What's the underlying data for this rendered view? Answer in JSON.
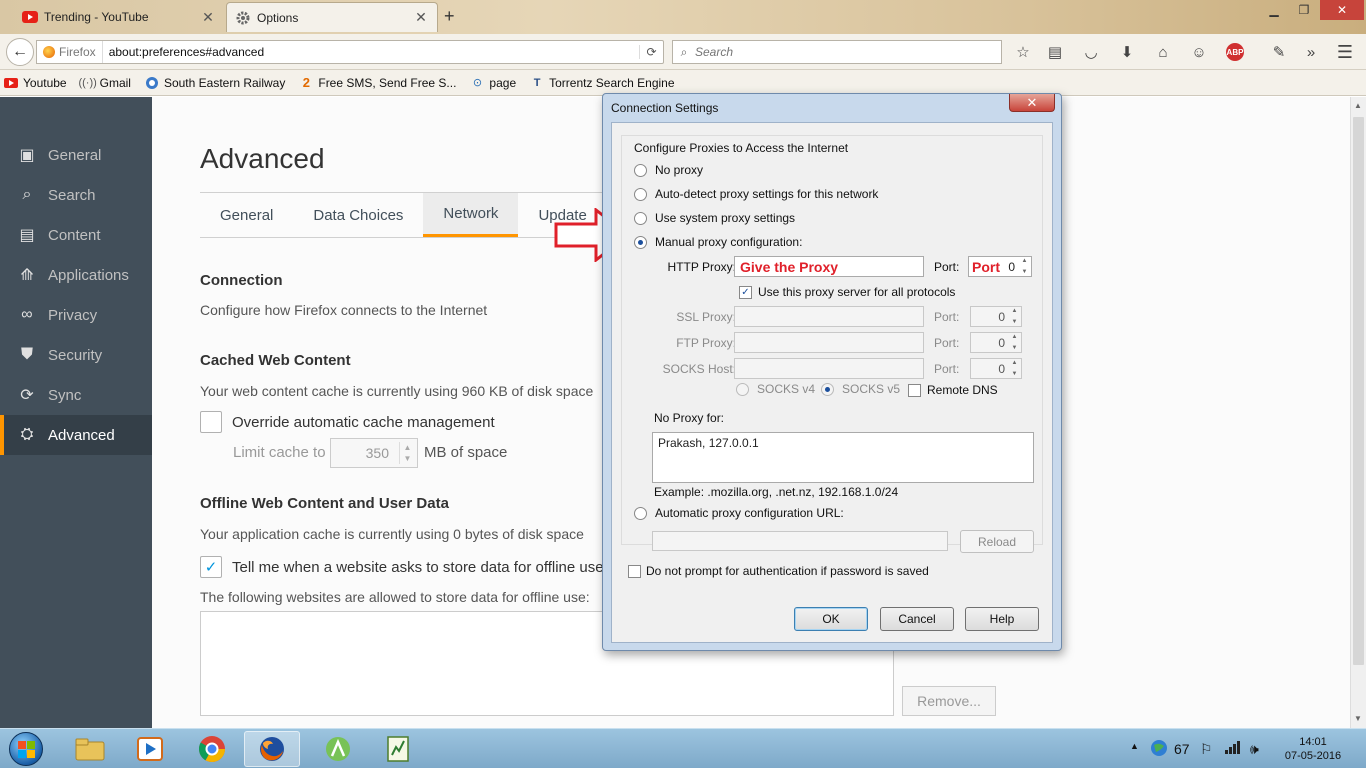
{
  "tabs": [
    {
      "title": "Trending - YouTube",
      "active": false
    },
    {
      "title": "Options",
      "active": true
    }
  ],
  "navbar": {
    "identity_label": "Firefox",
    "url": "about:preferences#advanced",
    "search_placeholder": "Search"
  },
  "bookmarks": [
    {
      "label": "Youtube"
    },
    {
      "label": "Gmail"
    },
    {
      "label": "South Eastern Railway"
    },
    {
      "label": "Free SMS, Send Free S..."
    },
    {
      "label": "page"
    },
    {
      "label": "Torrentz Search Engine"
    }
  ],
  "sidebar": {
    "items": [
      {
        "label": "General",
        "icon": "general-icon"
      },
      {
        "label": "Search",
        "icon": "search-icon"
      },
      {
        "label": "Content",
        "icon": "content-icon"
      },
      {
        "label": "Applications",
        "icon": "applications-icon"
      },
      {
        "label": "Privacy",
        "icon": "privacy-mask-icon"
      },
      {
        "label": "Security",
        "icon": "security-icon"
      },
      {
        "label": "Sync",
        "icon": "sync-icon"
      },
      {
        "label": "Advanced",
        "icon": "advanced-icon",
        "selected": true
      }
    ]
  },
  "main": {
    "title": "Advanced",
    "subtabs": [
      "General",
      "Data Choices",
      "Network",
      "Update"
    ],
    "active_subtab": "Network",
    "connection": {
      "heading": "Connection",
      "description": "Configure how Firefox connects to the Internet"
    },
    "cache": {
      "heading": "Cached Web Content",
      "description": "Your web content cache is currently using 960 KB of disk space",
      "override_label": "Override automatic cache management",
      "override_checked": false,
      "limit_label": "Limit cache to",
      "limit_value": "350",
      "limit_unit": "MB of space"
    },
    "offline": {
      "heading": "Offline Web Content and User Data",
      "description": "Your application cache is currently using 0 bytes of disk space",
      "tell_me_label": "Tell me when a website asks to store data for offline use",
      "tell_me_checked": true,
      "allowed_label": "The following websites are allowed to store data for offline use:",
      "remove_label": "Remove..."
    }
  },
  "dialog": {
    "title": "Connection Settings",
    "group_legend": "Configure Proxies to Access the Internet",
    "options": [
      {
        "label": "No proxy",
        "checked": false
      },
      {
        "label": "Auto-detect proxy settings for this network",
        "checked": false
      },
      {
        "label": "Use system proxy settings",
        "checked": false
      },
      {
        "label": "Manual proxy configuration:",
        "checked": true
      }
    ],
    "http_proxy_label": "HTTP Proxy:",
    "http_proxy_value": "Give the Proxy",
    "port_label": "Port:",
    "http_port_annotation": "Port",
    "http_port_value": "0",
    "use_for_all_label": "Use this proxy server for all protocols",
    "use_for_all_checked": true,
    "ssl_proxy_label": "SSL Proxy:",
    "ssl_port_value": "0",
    "ftp_proxy_label": "FTP Proxy:",
    "ftp_port_value": "0",
    "socks_host_label": "SOCKS Host:",
    "socks_port_value": "0",
    "socks_v4_label": "SOCKS v4",
    "socks_v5_label": "SOCKS v5",
    "remote_dns_label": "Remote DNS",
    "no_proxy_label": "No Proxy for:",
    "no_proxy_value": "Prakash, 127.0.0.1",
    "no_proxy_example": "Example: .mozilla.org, .net.nz, 192.168.1.0/24",
    "auto_url_label": "Automatic proxy configuration URL:",
    "reload_label": "Reload",
    "no_prompt_label": "Do not prompt for authentication if password is saved",
    "ok_label": "OK",
    "cancel_label": "Cancel",
    "help_label": "Help"
  },
  "taskbar": {
    "tray_number": "67",
    "time": "14:01",
    "date": "07-05-2016"
  },
  "colors": {
    "sidebar_bg": "#424f5a",
    "accent_orange": "#ff9500",
    "annotation_red": "#e0202a",
    "dialog_frame": "#c8d9ec"
  }
}
